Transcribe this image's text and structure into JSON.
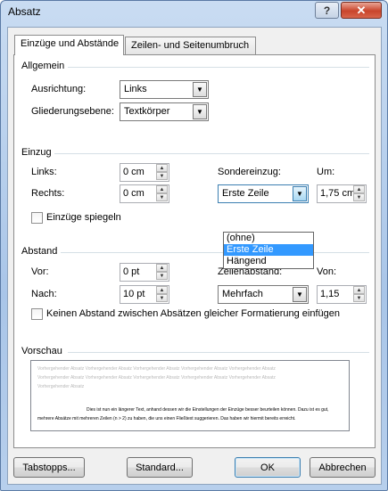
{
  "window": {
    "title": "Absatz",
    "help_label": "?",
    "close_label": "✕"
  },
  "tabs": [
    {
      "label": "Einzüge und Abstände",
      "active": true
    },
    {
      "label": "Zeilen- und Seitenumbruch",
      "active": false
    }
  ],
  "allgemein": {
    "heading": "Allgemein",
    "ausrichtung_label": "Ausrichtung:",
    "ausrichtung_value": "Links",
    "gliederung_label": "Gliederungsebene:",
    "gliederung_value": "Textkörper"
  },
  "einzug": {
    "heading": "Einzug",
    "links_label": "Links:",
    "links_value": "0 cm",
    "rechts_label": "Rechts:",
    "rechts_value": "0 cm",
    "sondereinzug_label": "Sondereinzug:",
    "sondereinzug_value": "Erste Zeile",
    "um_label": "Um:",
    "um_value": "1,75 cm",
    "spiegeln_label": "Einzüge spiegeln",
    "dropdown_options": [
      "(ohne)",
      "Erste Zeile",
      "Hängend"
    ],
    "dropdown_selected": "Erste Zeile"
  },
  "abstand": {
    "heading": "Abstand",
    "vor_label": "Vor:",
    "vor_value": "0 pt",
    "nach_label": "Nach:",
    "nach_value": "10 pt",
    "zeilenabstand_label": "Zeilenabstand:",
    "zeilenabstand_value": "Mehrfach",
    "von_label": "Von:",
    "von_value": "1,15",
    "kein_abstand_label": "Keinen Abstand zwischen Absätzen gleicher Formatierung einfügen"
  },
  "vorschau": {
    "heading": "Vorschau",
    "gray_text": "Vorhergehender Absatz Vorhergehender Absatz Vorhergehender Absatz Vorhergehender Absatz Vorhergehender Absatz Vorhergehender Absatz Vorhergehender Absatz Vorhergehender Absatz Vorhergehender Absatz Vorhergehender Absatz Vorhergehender Absatz",
    "main_text": "Dies ist nun ein längerer Text, anhand dessen wir die Einstellungen der Einzüge besser beurteilen können. Dazu ist es gut, mehrere Absätze mit mehreren Zeilen (n > 2) zu haben, die uns einen Fließtext suggerieren. Das haben wir hiermit bereits erreicht."
  },
  "buttons": {
    "tabstopps": "Tabstopps...",
    "standard": "Standard...",
    "ok": "OK",
    "abbrechen": "Abbrechen"
  }
}
